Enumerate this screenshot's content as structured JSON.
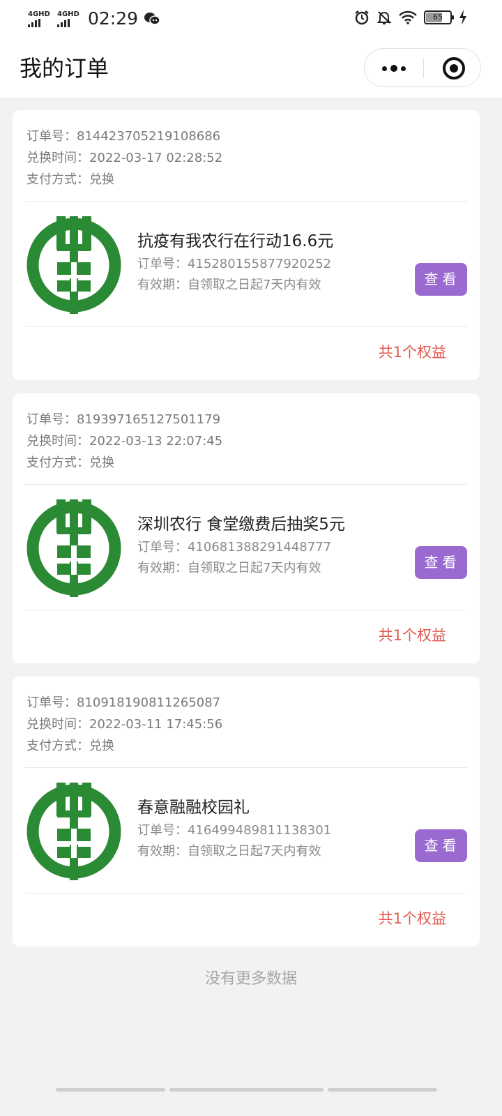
{
  "status_bar": {
    "signal1": "4GHD",
    "signal2": "4GHD",
    "time": "02:29",
    "battery": "65",
    "battery_level": 0.65,
    "icons": [
      "wechat-icon",
      "alarm-icon",
      "mute-icon",
      "wifi-icon",
      "charging-icon"
    ]
  },
  "nav": {
    "title": "我的订单",
    "more_icon": "more-dots-icon",
    "close_icon": "target-close-icon"
  },
  "orders": [
    {
      "order_no": "订单号：814423705219108686",
      "time": "兑换时间：2022-03-17 02:28:52",
      "pay": "支付方式：兑换",
      "item_title": "抗疫有我农行在行动16.6元",
      "item_no": "订单号：415280155877920252",
      "validity": "有效期：自领取之日起7天内有效",
      "button": "查看",
      "summary": "共1个权益"
    },
    {
      "order_no": "订单号：819397165127501179",
      "time": "兑换时间：2022-03-13 22:07:45",
      "pay": "支付方式：兑换",
      "item_title": "深圳农行 食堂缴费后抽奖5元",
      "item_no": "订单号：410681388291448777",
      "validity": "有效期：自领取之日起7天内有效",
      "button": "查看",
      "summary": "共1个权益"
    },
    {
      "order_no": "订单号：810918190811265087",
      "time": "兑换时间：2022-03-11 17:45:56",
      "pay": "支付方式：兑换",
      "item_title": "春意融融校园礼",
      "item_no": "订单号：416499489811138301",
      "validity": "有效期：自领取之日起7天内有效",
      "button": "查看",
      "summary": "共1个权益"
    }
  ],
  "footer": {
    "no_more": "没有更多数据"
  },
  "colors": {
    "accent_button": "#9a6ad0",
    "summary_text": "#e05a4f",
    "logo_green": "#2b8a34",
    "background": "#f2f2f3"
  }
}
